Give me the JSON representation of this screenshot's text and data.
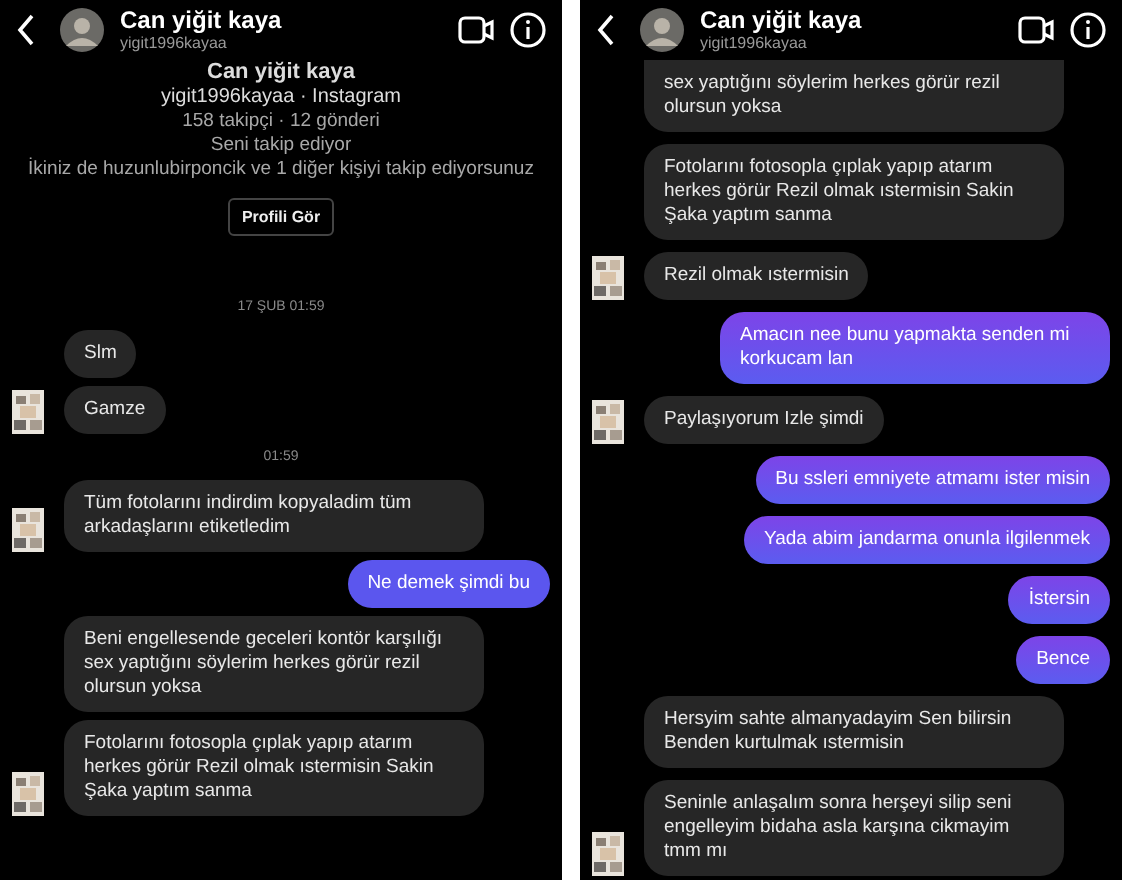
{
  "panels": [
    {
      "header": {
        "name": "Can yiğit kaya",
        "username": "yigit1996kayaa"
      },
      "profile": {
        "name": "Can yiğit kaya",
        "subtitle": "yigit1996kayaa · Instagram",
        "stats": "158 takipçi · 12 gönderi",
        "follows": "Seni takip ediyor",
        "mutual": "İkiniz de huzunlubirponcik ve 1 diğer kişiyi takip ediyorsunuz",
        "button": "Profili Gör"
      },
      "messages": [
        {
          "kind": "date",
          "text": "17 ŞUB 01:59"
        },
        {
          "kind": "in",
          "text": "Slm",
          "avatar": false
        },
        {
          "kind": "in",
          "text": "Gamze",
          "avatar": true
        },
        {
          "kind": "date",
          "text": "01:59"
        },
        {
          "kind": "in",
          "text": "Tüm fotolarını indirdim kopyaladim tüm arkadaşlarını etiketledim",
          "avatar": true
        },
        {
          "kind": "out",
          "text": "Ne demek şimdi bu"
        },
        {
          "kind": "in",
          "text": "Beni engellesende geceleri kontör karşılığı sex yaptığını söylerim herkes görür rezil olursun yoksa",
          "avatar": false
        },
        {
          "kind": "in",
          "text": "Fotolarını fotosopla çıplak yapıp atarım herkes görür Rezil olmak ıstermisin Sakin Şaka yaptım sanma",
          "avatar": true
        }
      ]
    },
    {
      "header": {
        "name": "Can yiğit kaya",
        "username": "yigit1996kayaa"
      },
      "messages": [
        {
          "kind": "in",
          "text": "sex yaptığını söylerim herkes görür rezil olursun yoksa",
          "avatar": false,
          "cut": true
        },
        {
          "kind": "in",
          "text": "Fotolarını fotosopla çıplak yapıp atarım herkes görür Rezil olmak ıstermisin Sakin Şaka yaptım sanma",
          "avatar": false
        },
        {
          "kind": "in",
          "text": "Rezil olmak ıstermisin",
          "avatar": true
        },
        {
          "kind": "out",
          "text": "Amacın nee bunu yapmakta senden mi korkucam lan"
        },
        {
          "kind": "in",
          "text": "Paylaşıyorum Izle şimdi",
          "avatar": true
        },
        {
          "kind": "out",
          "text": "Bu ssleri emniyete atmamı ister misin"
        },
        {
          "kind": "out",
          "text": "Yada abim jandarma onunla ilgilenmek"
        },
        {
          "kind": "out",
          "text": "İstersin"
        },
        {
          "kind": "out",
          "text": "Bence"
        },
        {
          "kind": "in",
          "text": "Hersyim sahte almanyadayim Sen bilirsin Benden kurtulmak ıstermisin",
          "avatar": false
        },
        {
          "kind": "in",
          "text": "Seninle anlaşalım sonra herşeyi silip seni engelleyim bidaha asla karşına cikmayim tmm mı",
          "avatar": true
        }
      ]
    }
  ]
}
